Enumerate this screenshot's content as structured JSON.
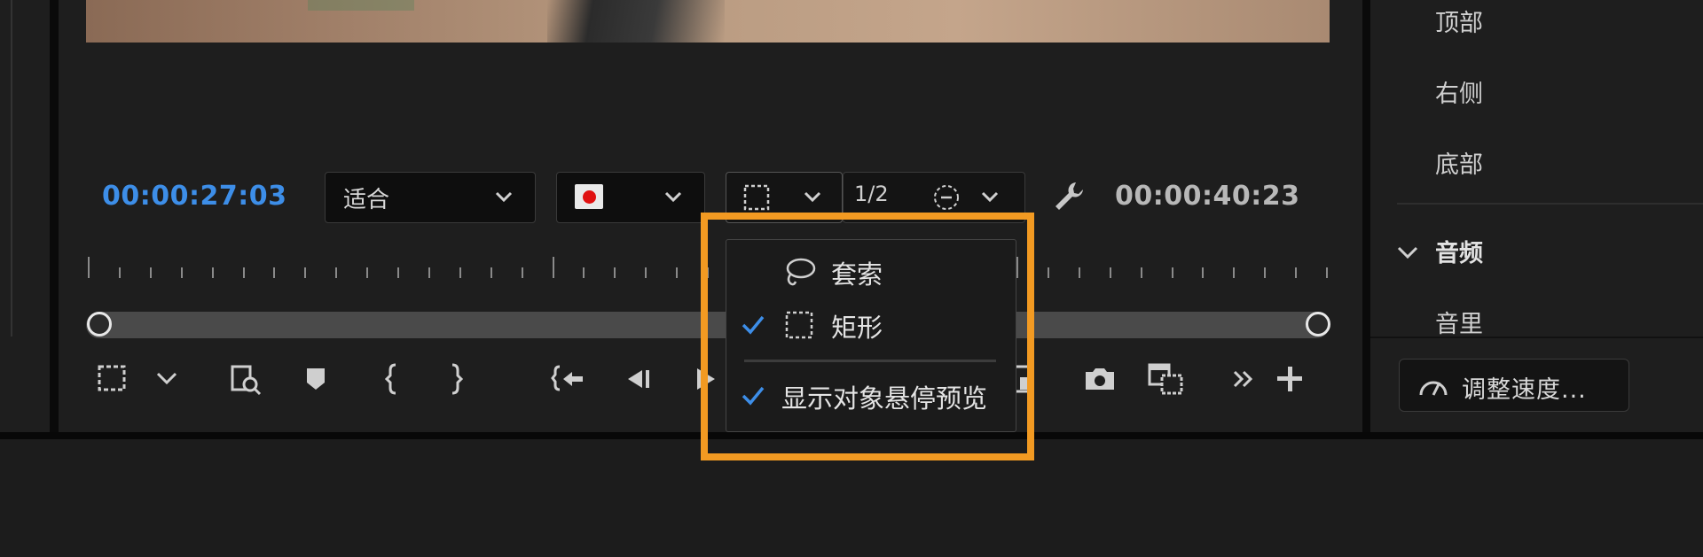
{
  "timecode_current": "00:00:27:03",
  "timecode_duration": "00:00:40:23",
  "zoom_select": {
    "value": "适合"
  },
  "resolution_select": {
    "value": "1/2"
  },
  "selection_menu": {
    "items": [
      {
        "label": "套索",
        "icon": "lasso-icon",
        "checked": false
      },
      {
        "label": "矩形",
        "icon": "rectangle-select-icon",
        "checked": true
      }
    ],
    "option": {
      "label": "显示对象悬停预览",
      "checked": true
    }
  },
  "right_panel": {
    "items": [
      "顶部",
      "右侧",
      "底部"
    ],
    "section": "音频",
    "sub_item": "音里",
    "speed_button": "调整速度..."
  },
  "colors": {
    "accent_timecode": "#3d8ee8",
    "highlight": "#f29a22",
    "record": "#e01010",
    "check": "#3d8ee8"
  }
}
